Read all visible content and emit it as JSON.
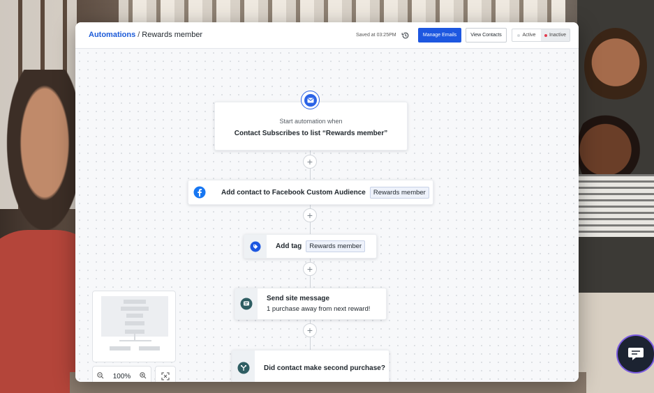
{
  "header": {
    "breadcrumb_root": "Automations",
    "breadcrumb_separator": "/",
    "breadcrumb_current": "Rewards member",
    "saved_text": "Saved at 03:25PM",
    "manage_emails_label": "Manage Emails",
    "view_contacts_label": "View Contacts",
    "status_active_label": "Active",
    "status_inactive_label": "Inactive",
    "status_selected": "Inactive"
  },
  "workflow": {
    "trigger": {
      "label": "Start automation when",
      "value": "Contact Subscribes to list “Rewards member”"
    },
    "steps": [
      {
        "icon": "facebook-icon",
        "title": "Add contact to Facebook Custom Audience",
        "pill": "Rewards member"
      },
      {
        "icon": "tag-icon",
        "title": "Add tag",
        "pill": "Rewards member"
      },
      {
        "icon": "site-message-icon",
        "title": "Send site message",
        "subtitle": "1 purchase away from next reward!"
      },
      {
        "icon": "condition-icon",
        "title": "Did contact make second purchase?"
      }
    ],
    "add_symbol": "+"
  },
  "zoom": {
    "level": "100%"
  },
  "colors": {
    "primary": "#1d57e0",
    "facebook": "#1877f2",
    "inactive_dot": "#e23b4e",
    "chat_bubble": "#1c2331"
  }
}
